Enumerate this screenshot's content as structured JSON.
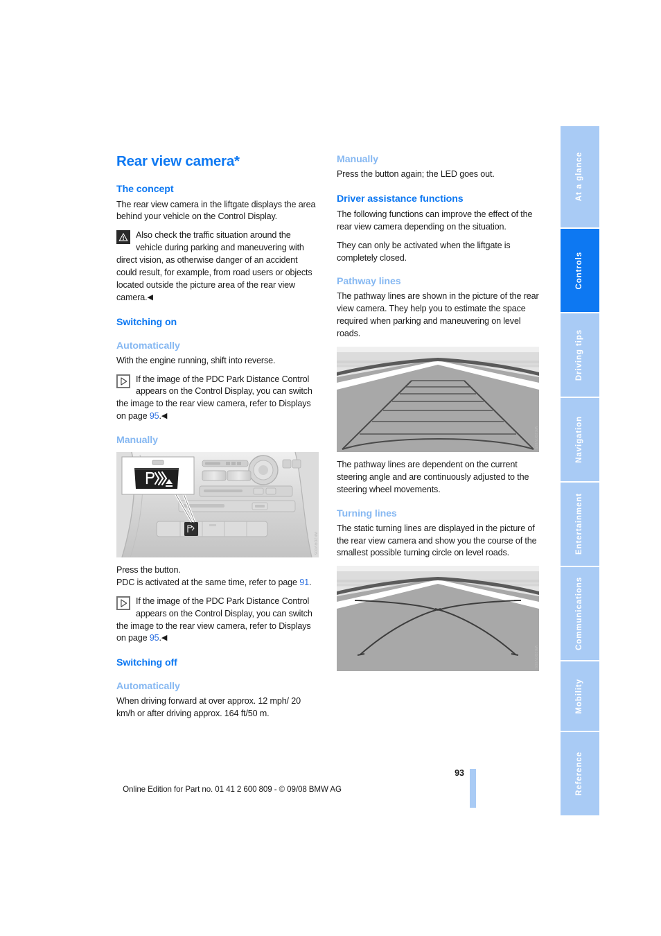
{
  "document": {
    "title": "Rear view camera*",
    "page_number": "93",
    "footer_text": "Online Edition for Part no. 01 41 2 600 809 - © 09/08 BMW AG"
  },
  "tabs": [
    {
      "label": "At a glance",
      "active": false
    },
    {
      "label": "Controls",
      "active": true
    },
    {
      "label": "Driving tips",
      "active": false
    },
    {
      "label": "Navigation",
      "active": false
    },
    {
      "label": "Entertainment",
      "active": false
    },
    {
      "label": "Communications",
      "active": false
    },
    {
      "label": "Mobility",
      "active": false
    },
    {
      "label": "Reference",
      "active": false
    }
  ],
  "left_column": {
    "concept_heading": "The concept",
    "concept_p1": "The rear view camera in the liftgate displays the area behind your vehicle on the Control Display.",
    "concept_warning": "Also check the traffic situation around the vehicle during parking and maneuvering with direct vision, as otherwise danger of an accident could result, for example, from road users or objects located outside the picture area of the rear view camera.",
    "switching_on_heading": "Switching on",
    "auto_on_subhead": "Automatically",
    "auto_on_p1": "With the engine running, shift into reverse.",
    "auto_on_note_a": "If the image of the PDC Park Distance Control appears on the Control Display, you can switch the image to the rear view camera, refer to Displays on page ",
    "auto_on_note_page": "95",
    "auto_on_note_b": ".",
    "manual_on_subhead": "Manually",
    "console_figure_code": "WK2DRV005",
    "manual_on_p1": "Press the button.",
    "manual_on_p2a": "PDC is activated at the same time, refer to page ",
    "manual_on_p2_page": "91",
    "manual_on_p2b": ".",
    "manual_on_note_a": "If the image of the PDC Park Distance Control appears on the Control Display, you can switch the image to the rear view camera, refer to Displays on page ",
    "manual_on_note_page": "95",
    "manual_on_note_b": ".",
    "switching_off_heading": "Switching off",
    "auto_off_subhead": "Automatically",
    "auto_off_p1": "When driving forward at over approx. 12 mph/ 20 km/h or after driving approx. 164 ft/50 m."
  },
  "right_column": {
    "manual_off_subhead": "Manually",
    "manual_off_p1": "Press the button again; the LED goes out.",
    "driver_assist_heading": "Driver assistance functions",
    "driver_assist_p1": "The following functions can improve the effect of the rear view camera depending on the situation.",
    "driver_assist_p2": "They can only be activated when the liftgate is completely closed.",
    "pathway_subhead": "Pathway lines",
    "pathway_p1": "The pathway lines are shown in the picture of the rear view camera. They help you to estimate the space required when parking and maneuvering on level roads.",
    "pathway_figure_code": "WK2DRV005",
    "pathway_p2": "The pathway lines are dependent on the current steering angle and are continuously adjusted to the steering wheel movements.",
    "turning_subhead": "Turning lines",
    "turning_p1": "The static turning lines are displayed in the picture of the rear view camera and show you the course of the smallest possible turning circle on level roads.",
    "turning_figure_code": "WK2DRV005"
  },
  "icons": {
    "warning": "warning-triangle-icon",
    "info": "note-triangle-icon",
    "end_marker": "◀"
  },
  "colors": {
    "heading_blue": "#0d78f2",
    "subheading_blue": "#86b8f2",
    "tab_inactive": "#a9cbf5",
    "tab_active": "#0d78f2",
    "page_ref": "#2b6fe0"
  }
}
